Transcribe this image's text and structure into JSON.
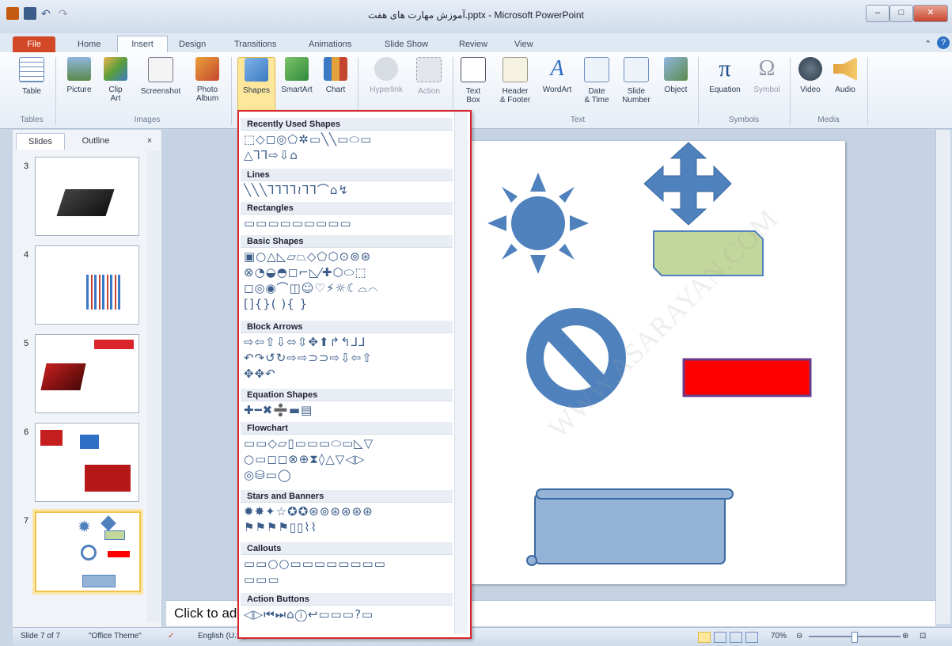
{
  "window": {
    "title": "آموزش مهارت های هفت.pptx - Microsoft PowerPoint"
  },
  "tabs": [
    "File",
    "Home",
    "Insert",
    "Design",
    "Transitions",
    "Animations",
    "Slide Show",
    "Review",
    "View"
  ],
  "ribbon": {
    "tables": {
      "table": "Table",
      "group": "Tables"
    },
    "images": {
      "picture": "Picture",
      "clip_art_1": "Clip",
      "clip_art_2": "Art",
      "screenshot": "Screenshot",
      "photo_album_1": "Photo",
      "photo_album_2": "Album",
      "group": "Images"
    },
    "illustrations": {
      "shapes": "Shapes",
      "smartart": "SmartArt",
      "chart": "Chart"
    },
    "links": {
      "hyperlink": "Hyperlink",
      "action": "Action"
    },
    "text": {
      "textbox_1": "Text",
      "textbox_2": "Box",
      "header_1": "Header",
      "header_2": "& Footer",
      "wordart": "WordArt",
      "datetime_1": "Date",
      "datetime_2": "& Time",
      "slidenum_1": "Slide",
      "slidenum_2": "Number",
      "object": "Object",
      "group": "Text"
    },
    "symbols": {
      "equation": "Equation",
      "symbol": "Symbol",
      "group": "Symbols"
    },
    "media": {
      "video": "Video",
      "audio": "Audio",
      "group": "Media"
    }
  },
  "panel": {
    "slides_tab": "Slides",
    "outline_tab": "Outline",
    "close": "×",
    "slide_numbers": [
      "3",
      "4",
      "5",
      "6",
      "7"
    ]
  },
  "gallery": {
    "sections": [
      {
        "title": "Recently Used Shapes",
        "rows": [
          "⬚◇◻◎⬠✲▭╲╲▭⬭▭",
          "△⅂⅂⇨⇩⌂"
        ]
      },
      {
        "title": "Lines",
        "rows": [
          "╲╲╲⅂⅂⅂⅂≀⅂⅂⌒⌂↯"
        ]
      },
      {
        "title": "Rectangles",
        "rows": [
          "▭▭▭▭▭▭▭▭▭"
        ]
      },
      {
        "title": "Basic Shapes",
        "rows": [
          "▣○△◺▱⏢◇⬠⬡⊙⊚⊛",
          "⊗◔◒◓◻⌐◺⁄✚⬡⬭⬚",
          "◻◎◉⌒◫☺♡⚡☼☾⌓⌒",
          "[]{}( ){ }"
        ]
      },
      {
        "title": "Block Arrows",
        "rows": [
          "⇨⇦⇧⇩⬄⇳✥⬆↱↰⅃⅃",
          "↶↷↺↻⇨⇨⊃⊃⇨⇩⇦⇧",
          "✥✥↶"
        ]
      },
      {
        "title": "Equation Shapes",
        "rows": [
          "✚━✖➗▬▤"
        ]
      },
      {
        "title": "Flowchart",
        "rows": [
          "▭▭◇▱▯▭▭▭⬭▭◺▽",
          "○▭◻◻⊗⊕⧗◊△▽◁▷",
          "◎⛁▭◯"
        ]
      },
      {
        "title": "Stars and Banners",
        "rows": [
          "✹✸✦☆✪✪⊛⊚⊛⊛⊛⊛",
          "⚑⚑⚑⚑▯▯⌇⌇"
        ]
      },
      {
        "title": "Callouts",
        "rows": [
          "▭▭○○▭▭▭▭▭▭▭▭",
          "▭▭▭"
        ]
      },
      {
        "title": "Action Buttons",
        "rows": [
          "◁▷⏮⏭⌂ⓘ↩▭▭▭?▭"
        ]
      }
    ]
  },
  "notes": {
    "placeholder": "Click to ad"
  },
  "status": {
    "slide": "Slide 7 of 7",
    "theme": "\"Office Theme\"",
    "lang": "English (U.S.)",
    "zoom": "70%"
  },
  "watermark": "WWW.ASARAYAN.COM",
  "colors": {
    "file_tab": "#d24726",
    "highlight": "#d9262d",
    "shape_blue": "#4f81bd",
    "shape_green": "#c3d69b",
    "shape_red": "#ff0000"
  }
}
